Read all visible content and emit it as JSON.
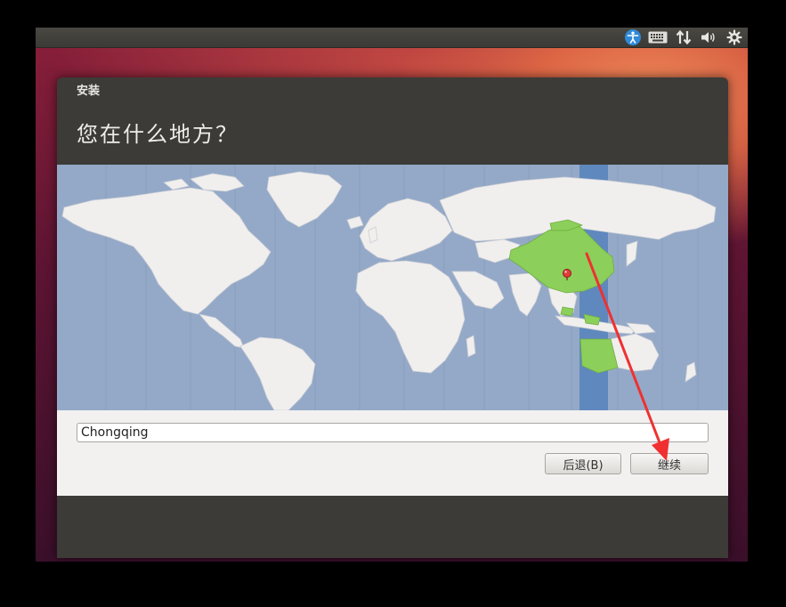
{
  "panel": {
    "icons": [
      "accessibility-icon",
      "keyboard-icon",
      "network-icon",
      "volume-icon",
      "gear-icon"
    ]
  },
  "window": {
    "title": "安装"
  },
  "page": {
    "heading": "您在什么地方？"
  },
  "map": {
    "highlight_color": "#8ccf5a",
    "ocean_color": "#94a9c7",
    "land_color": "#f1efee",
    "timezone_band_color": "#5f88be",
    "selected_region": "China",
    "pin_color": "#e23b3b"
  },
  "location": {
    "value": "Chongqing"
  },
  "buttons": {
    "back_label": "后退(B)",
    "continue_label": "继续"
  },
  "colors": {
    "annotation_arrow": "#f03030",
    "window_bg": "#3c3b37",
    "content_bg": "#f2f1f0"
  }
}
